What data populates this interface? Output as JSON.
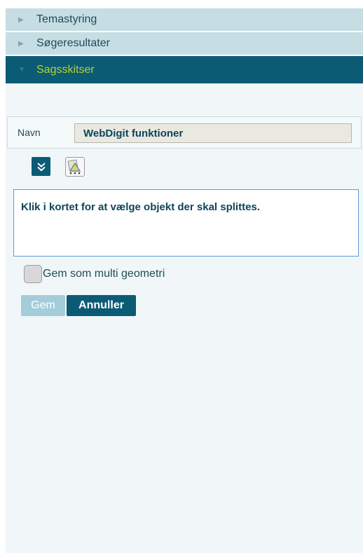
{
  "accordion": {
    "sections": [
      {
        "label": "Temastyring",
        "state": "collapsed"
      },
      {
        "label": "Søgeresultater",
        "state": "collapsed"
      },
      {
        "label": "Sagsskitser",
        "state": "expanded"
      }
    ]
  },
  "sketch": {
    "name_label": "Navn",
    "name_value": "WebDigit funktioner",
    "expand_icon": "double-chevron-down-icon",
    "snap_icon": "snap-settings-icon",
    "info_text": "Klik i kortet for at vælge objekt der skal splittes.",
    "multi_geometry_label": "Gem som multi geometri",
    "multi_geometry_checked": false,
    "save_label": "Gem",
    "save_enabled": false,
    "cancel_label": "Annuller"
  },
  "colors": {
    "accent": "#0b5b75",
    "active_text": "#b5d334",
    "collapsed_header": "#c6dde4",
    "panel_bg": "#f1f7f8",
    "disabled_button": "#a5cdd9"
  }
}
